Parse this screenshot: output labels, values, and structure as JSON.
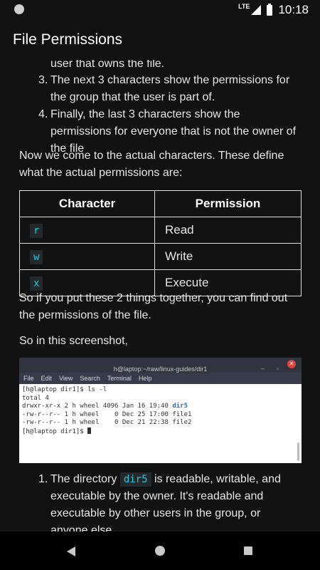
{
  "status_bar": {
    "network": "LTE",
    "time": "10:18"
  },
  "app_bar": {
    "title": "File Permissions"
  },
  "list_top": [
    {
      "number": "",
      "text": "user that owns the file."
    },
    {
      "number": "3.",
      "text": "The next 3 characters show the permissions for the group that the user is part of."
    },
    {
      "number": "4.",
      "text": "Finally, the last 3 characters show the permissions for everyone that is not the owner of the file"
    }
  ],
  "para1": "Now we come to the actual characters. These define what the actual permissions are:",
  "table": {
    "headers": [
      "Character",
      "Permission"
    ],
    "rows": [
      {
        "char": "r",
        "perm": "Read"
      },
      {
        "char": "w",
        "perm": "Write"
      },
      {
        "char": "x",
        "perm": "Execute"
      }
    ]
  },
  "para2": "So if you put these 2 things together, you can find out the permissions of the file.",
  "para3": "So in this screenshot,",
  "terminal": {
    "title": "h@laptop:~/raw/linux-guides/dir1",
    "menu": [
      "File",
      "Edit",
      "View",
      "Search",
      "Terminal",
      "Help"
    ],
    "lines": [
      "[h@laptop dir1]$ ls -l",
      "total 4",
      "drwxr-xr-x 2 h wheel 4096 Jan 16 19:40 ",
      "-rw-r--r-- 1 h wheel    0 Dec 25 17:00 file1",
      "-rw-r--r-- 1 h wheel    0 Dec 21 22:38 file2",
      "[h@laptop dir1]$ "
    ],
    "dir_name": "dir5"
  },
  "list_bottom": {
    "number": "1.",
    "pre": "The directory ",
    "code": "dir5",
    "post": " is readable, writable, and executable by the owner. It's readable and executable by other users in the group, or anyone else."
  }
}
